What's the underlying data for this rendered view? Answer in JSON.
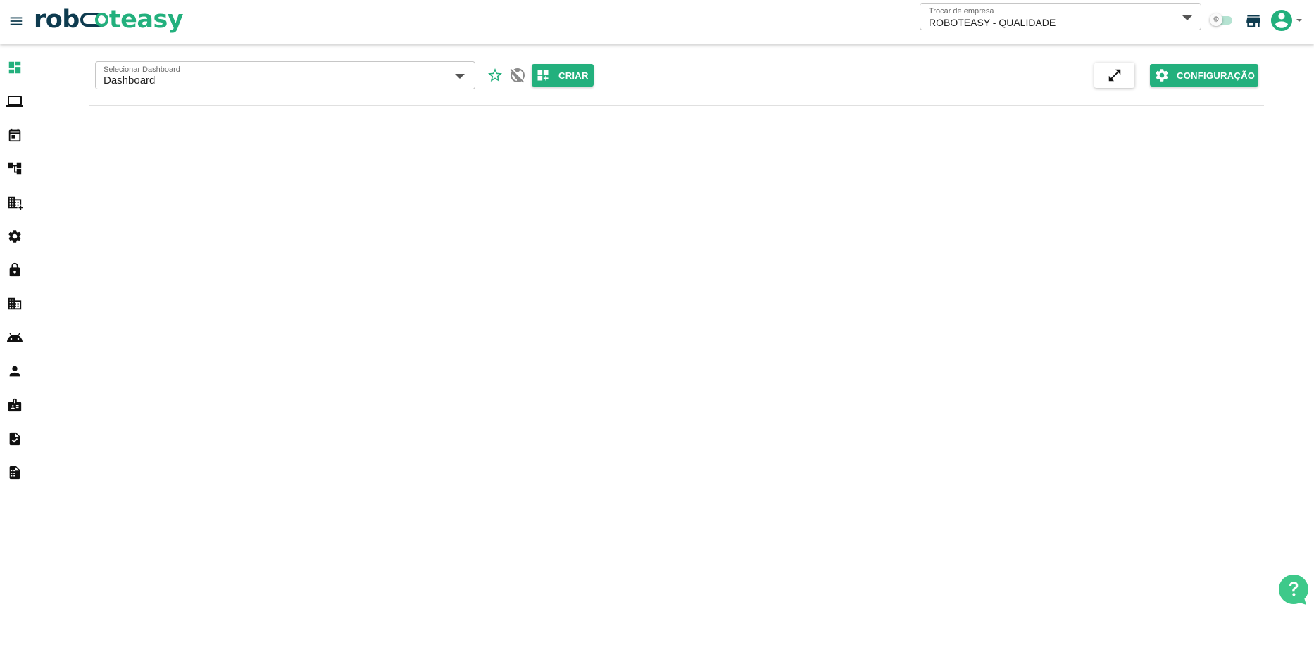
{
  "header": {
    "logo_part1": "rob",
    "logo_part2": "teasy",
    "company_select": {
      "label": "Trocar de empresa",
      "value": "ROBOTEASY - QUALIDADE"
    }
  },
  "sidebar": {
    "items": [
      {
        "name": "dashboard",
        "icon": "dashboard-icon"
      },
      {
        "name": "devices",
        "icon": "laptop-icon"
      },
      {
        "name": "calendar",
        "icon": "calendar-icon"
      },
      {
        "name": "workflow",
        "icon": "account-tree-icon"
      },
      {
        "name": "add-company",
        "icon": "domain-add-icon"
      },
      {
        "name": "settings",
        "icon": "gear-icon"
      },
      {
        "name": "security",
        "icon": "lock-icon"
      },
      {
        "name": "company",
        "icon": "business-icon"
      },
      {
        "name": "robots",
        "icon": "android-icon"
      },
      {
        "name": "users",
        "icon": "person-icon"
      },
      {
        "name": "badges",
        "icon": "badge-icon"
      },
      {
        "name": "tasks",
        "icon": "task-icon"
      },
      {
        "name": "reports",
        "icon": "report-icon"
      }
    ]
  },
  "toolbar": {
    "dashboard_select": {
      "label": "Selecionar Dashboard",
      "value": "Dashboard"
    },
    "create_label": "CRIAR",
    "config_label": "CONFIGURAÇÃO"
  },
  "colors": {
    "brand_green": "#23b07d",
    "brand_navy": "#0e3b4f"
  }
}
